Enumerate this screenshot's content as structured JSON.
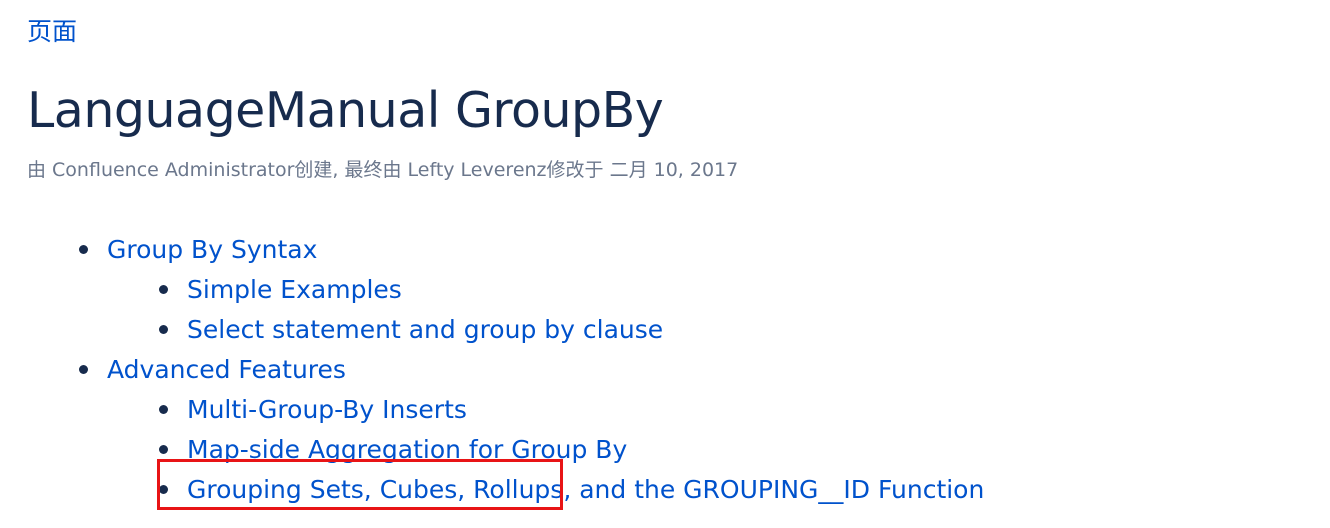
{
  "breadcrumb": {
    "label": "页面"
  },
  "page": {
    "title": "LanguageManual GroupBy",
    "byline": "由 Confluence Administrator创建, 最终由 Lefty Leverenz修改于 二月 10, 2017"
  },
  "toc": {
    "items": [
      {
        "label": "Group By Syntax",
        "level": 1
      },
      {
        "label": "Simple Examples",
        "level": 2
      },
      {
        "label": "Select statement and group by clause",
        "level": 2
      },
      {
        "label": "Advanced Features",
        "level": 1
      },
      {
        "label": "Multi-Group-By Inserts",
        "level": 2
      },
      {
        "label": "Map-side Aggregation for Group By",
        "level": 2
      },
      {
        "label": "Grouping Sets, Cubes, Rollups, and the GROUPING__ID Function",
        "level": 2
      }
    ]
  },
  "colors": {
    "link": "#0052cc",
    "text": "#172b4d",
    "muted": "#6b778c",
    "highlight": "#e81416"
  }
}
